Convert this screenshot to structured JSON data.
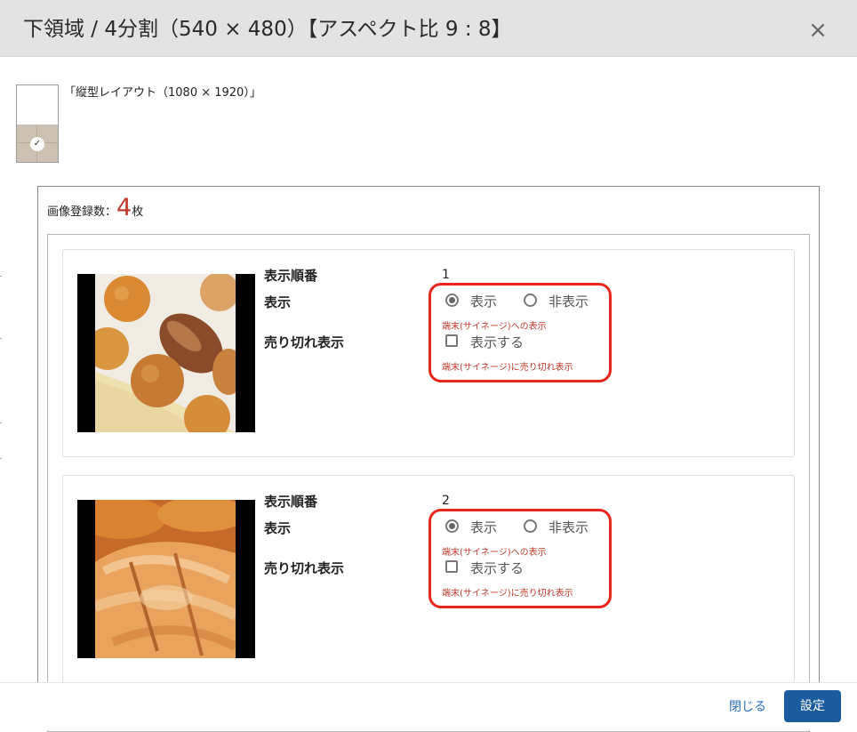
{
  "dialog": {
    "title": "下領域 / 4分割（540 × 480）【アスペクト比 9 : 8】",
    "close_icon": "×"
  },
  "layout": {
    "label": "「縦型レイアウト（1080 × 1920）」",
    "check_icon": "✓"
  },
  "registration": {
    "label": "画像登録数：",
    "count": "4",
    "unit": "枚"
  },
  "field_labels": {
    "order": "表示順番",
    "display": "表示",
    "sold_out": "売り切れ表示"
  },
  "options": {
    "show": "表示",
    "hide": "非表示",
    "sold_out_checkbox": "表示する",
    "display_hint": "端末(サイネージ)への表示",
    "sold_out_hint": "端末(サイネージ)に売り切れ表示"
  },
  "items": [
    {
      "order": "1",
      "display": "表示",
      "sold_out": false,
      "image_icon": "bread-assortment-photo"
    },
    {
      "order": "2",
      "display": "表示",
      "sold_out": false,
      "image_icon": "croissant-photo"
    }
  ],
  "footer": {
    "close": "閉じる",
    "set": "設定"
  },
  "colors": {
    "accent": "#1b5c9e",
    "highlight": "#e8261b",
    "count": "#c0392b"
  }
}
